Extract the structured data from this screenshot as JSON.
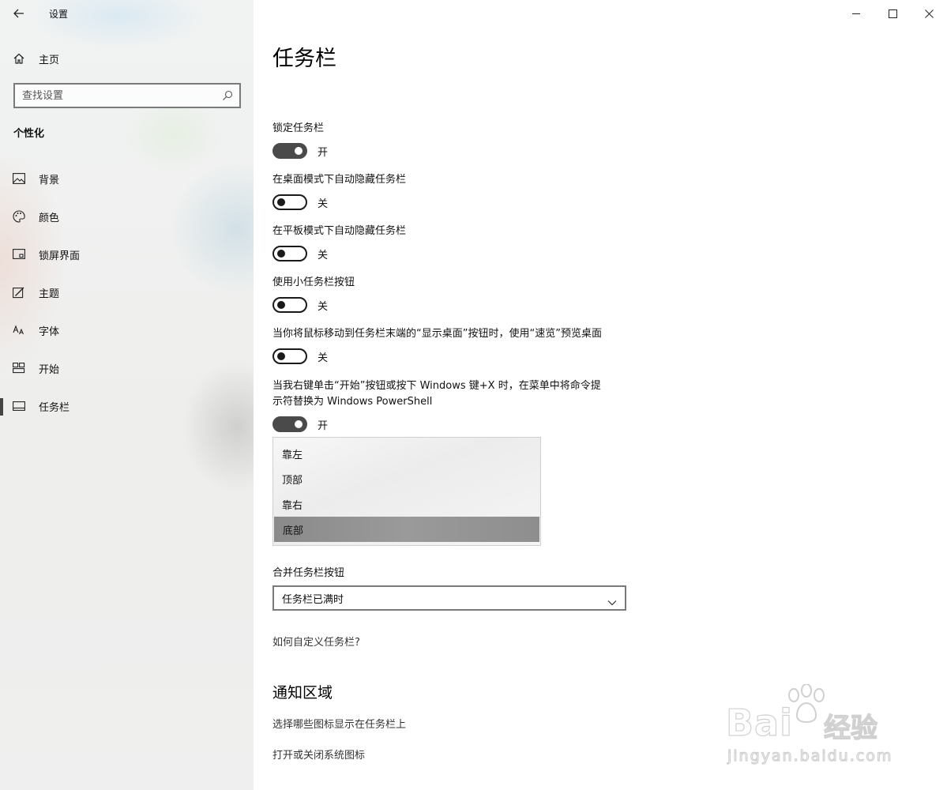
{
  "window": {
    "app_title": "设置"
  },
  "sidebar": {
    "home_label": "主页",
    "search_placeholder": "查找设置",
    "section_heading": "个性化",
    "items": [
      {
        "label": "背景",
        "icon": "picture-icon"
      },
      {
        "label": "颜色",
        "icon": "palette-icon"
      },
      {
        "label": "锁屏界面",
        "icon": "lock-screen-icon"
      },
      {
        "label": "主题",
        "icon": "theme-icon"
      },
      {
        "label": "字体",
        "icon": "font-icon"
      },
      {
        "label": "开始",
        "icon": "start-icon"
      },
      {
        "label": "任务栏",
        "icon": "taskbar-icon",
        "active": true
      }
    ]
  },
  "main": {
    "page_title": "任务栏",
    "settings": [
      {
        "label": "锁定任务栏",
        "state": "开",
        "on": true
      },
      {
        "label": "在桌面模式下自动隐藏任务栏",
        "state": "关",
        "on": false
      },
      {
        "label": "在平板模式下自动隐藏任务栏",
        "state": "关",
        "on": false
      },
      {
        "label": "使用小任务栏按钮",
        "state": "关",
        "on": false
      },
      {
        "label": "当你将鼠标移动到任务栏末端的“显示桌面”按钮时，使用“速览”预览桌面",
        "state": "关",
        "on": false
      },
      {
        "label_line1": "当我右键单击“开始”按钮或按下 Windows 键+X 时，在菜单中将命令提",
        "label_line2": "示符替换为 Windows PowerShell",
        "state": "开",
        "on": true
      }
    ],
    "position_options": [
      "靠左",
      "顶部",
      "靠右",
      "底部"
    ],
    "position_selected": "底部",
    "combine_label": "合并任务栏按钮",
    "combine_value": "任务栏已满时",
    "customize_link": "如何自定义任务栏?",
    "notification_title": "通知区域",
    "notification_links": [
      "选择哪些图标显示在任务栏上",
      "打开或关闭系统图标"
    ]
  },
  "watermark": {
    "brand": "Bai",
    "brand_suffix": "经验",
    "url": "jingyan.baidu.com"
  }
}
